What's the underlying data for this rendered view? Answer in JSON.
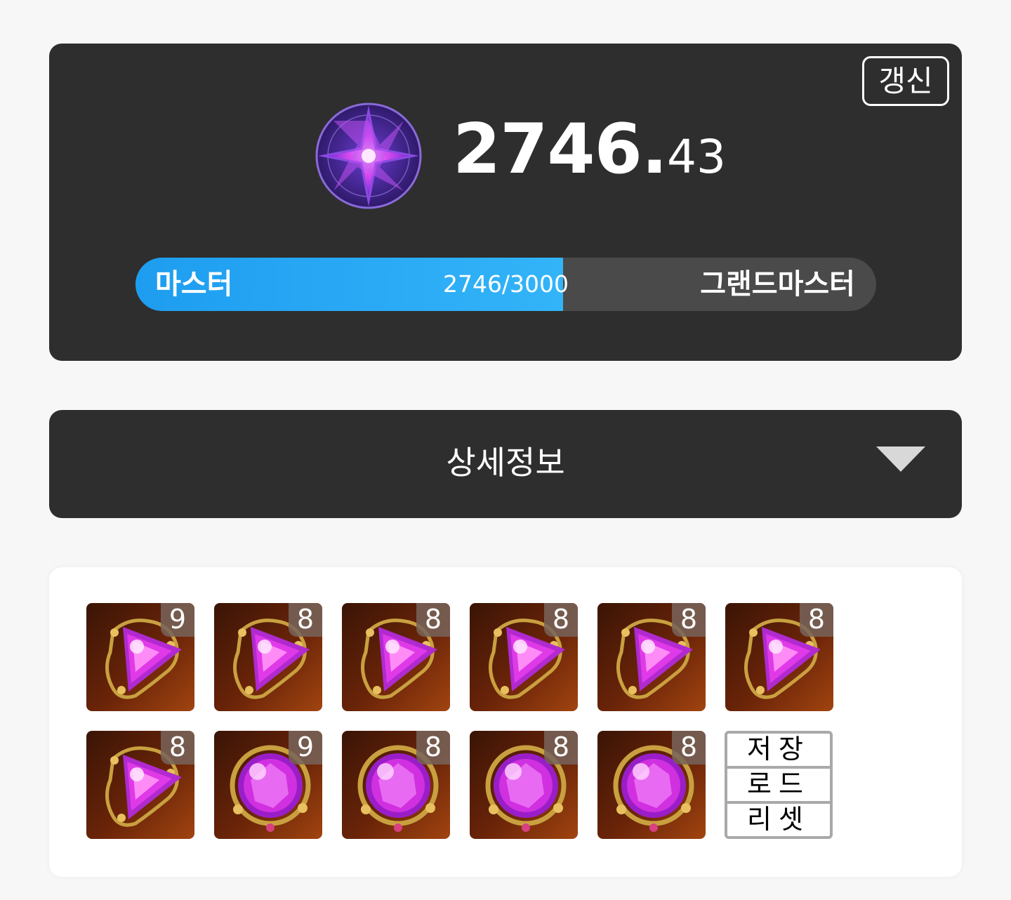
{
  "rating": {
    "refresh_label": "갱신",
    "emblem_icon": "grandmaster-star-emblem-icon",
    "score_int": "2746.",
    "score_dec": "43",
    "progress": {
      "fraction": 0.5773,
      "current_rank": "마스터",
      "next_rank": "그랜드마스터",
      "text": "2746/3000"
    }
  },
  "details": {
    "label": "상세정보",
    "toggle_icon": "triangle-down-icon"
  },
  "gems": {
    "row1": [
      {
        "type": "triangle-gem-icon",
        "level": "9"
      },
      {
        "type": "triangle-gem-icon",
        "level": "8"
      },
      {
        "type": "triangle-gem-icon",
        "level": "8"
      },
      {
        "type": "triangle-gem-icon",
        "level": "8"
      },
      {
        "type": "triangle-gem-icon",
        "level": "8"
      },
      {
        "type": "triangle-gem-icon",
        "level": "8"
      }
    ],
    "row2": [
      {
        "type": "triangle-gem-icon",
        "level": "8"
      },
      {
        "type": "round-gem-icon",
        "level": "9"
      },
      {
        "type": "round-gem-icon",
        "level": "8"
      },
      {
        "type": "round-gem-icon",
        "level": "8"
      },
      {
        "type": "round-gem-icon",
        "level": "8"
      }
    ],
    "actions": {
      "save": "저장",
      "load": "로드",
      "reset": "리셋"
    }
  },
  "colors": {
    "card_bg": "#2e2e2e",
    "progress_fill": "#1e9df0",
    "progress_track": "#4a4a4a",
    "gem_magenta": "#e03ae8",
    "tile_bg": "#6a2408"
  }
}
